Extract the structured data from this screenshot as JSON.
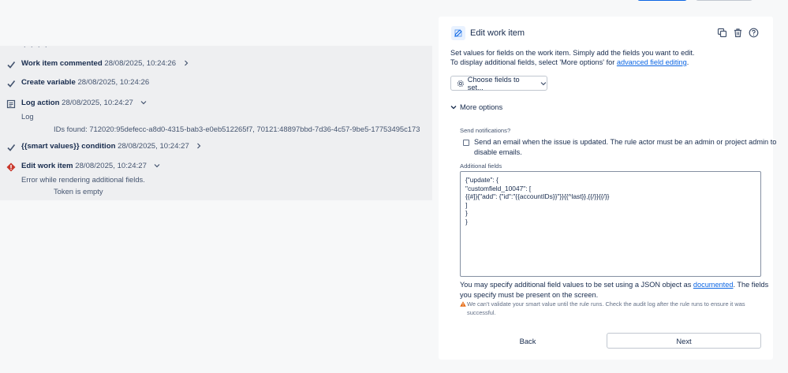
{
  "audit_log": {
    "stub_text": ". . . .",
    "items": [
      {
        "title": "Work item commented",
        "time": "28/08/2025, 10:24:26",
        "status": "success",
        "expander": "right"
      },
      {
        "title": "Create variable",
        "time": "28/08/2025, 10:24:26",
        "status": "success",
        "expander": "none"
      },
      {
        "title": "Log action",
        "time": "28/08/2025, 10:24:27",
        "status": "log",
        "expander": "down",
        "sub_label": "Log",
        "sub_detail": "IDs found: 712020:95defecc-a8d0-4315-bab3-e0eb512265f7, 70121:48897bbd-7d36-4c57-9be5-17753495c173"
      },
      {
        "title": "{{smart values}} condition",
        "time": "28/08/2025, 10:24:27",
        "status": "success",
        "expander": "right"
      },
      {
        "title": "Edit work item",
        "time": "28/08/2025, 10:24:27",
        "status": "error",
        "expander": "down",
        "sub_label": "Error while rendering additional fields.",
        "sub_detail": "Token is empty"
      }
    ]
  },
  "panel": {
    "title": "Edit work item",
    "icons": [
      "copy-icon",
      "trash-icon",
      "help-icon"
    ],
    "description_line1": "Set values for fields on the work item. Simply add the fields you want to edit.",
    "description_line2_prefix": "To display additional fields, select 'More options' for ",
    "description_link": "advanced field editing",
    "description_line2_suffix": ".",
    "choose_fields_label": "Choose fields to set...",
    "more_options_label": "More options",
    "send_notifications_label": "Send notifications?",
    "send_email_line1": "Send an email when the issue is updated. The rule actor must be an admin or project admin to",
    "send_email_line2": "disable emails.",
    "send_email_checked": false,
    "additional_fields_label": "Additional fields",
    "additional_fields_value": "{\"update\": {\n\"customfield_10047\": [\n{{#]}{\"add\": {\"id\":\"{{accountIDs}}\"}}{{^last}},{{/}}{{/}}\n]\n}\n}",
    "help_line1_prefix": "You may specify additional field values to be set using a JSON object as ",
    "help_link": "documented",
    "help_line1_suffix": ". The fields",
    "help_line2": "you specify must be present on the screen.",
    "warning_line1": "We can't validate your smart value until the rule runs. Check the audit log after the rule runs to ensure it was",
    "warning_line2": "successful.",
    "back_label": "Back",
    "next_label": "Next"
  },
  "colors": {
    "success": "#44546f",
    "error": "#c9372c",
    "link": "#0c66e4",
    "warning": "#e56910"
  }
}
